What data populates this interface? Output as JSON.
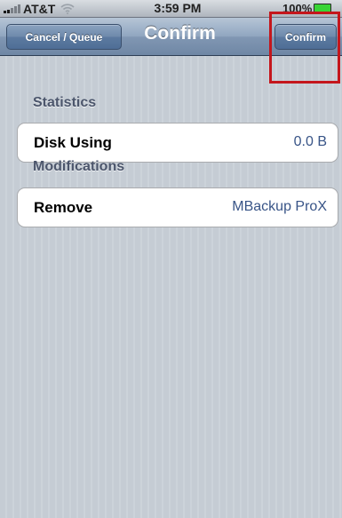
{
  "status_bar": {
    "carrier": "AT&T",
    "time": "3:59 PM",
    "battery": "100%",
    "icons": [
      "signal-bars-icon",
      "wifi-icon",
      "battery-icon"
    ]
  },
  "nav": {
    "back_label": "Cancel / Queue",
    "title": "Confirm",
    "confirm_label": "Confirm"
  },
  "sections": [
    {
      "header": "Statistics",
      "rows": [
        {
          "label": "Disk Using",
          "value": "0.0 B"
        }
      ]
    },
    {
      "header": "Modifications",
      "rows": [
        {
          "label": "Remove",
          "value": "MBackup ProX"
        }
      ]
    }
  ],
  "colors": {
    "nav_bar": "#7d93b0",
    "table_background": "#c5ccd4",
    "value_text": "#385487",
    "highlight_box": "#c4161c",
    "battery_fill": "#39d436"
  }
}
